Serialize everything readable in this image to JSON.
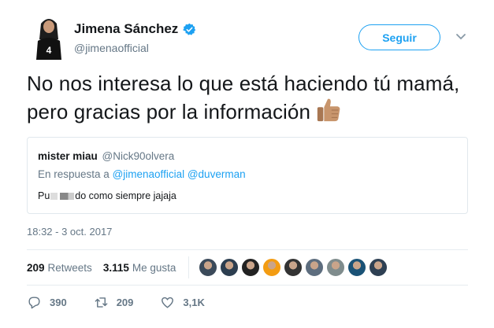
{
  "author": {
    "name": "Jimena Sánchez",
    "handle": "@jimenaofficial",
    "verified": true
  },
  "follow_label": "Seguir",
  "tweet_text": "No nos interesa lo que está haciendo tú mamá, pero gracias por la información",
  "quoted_tweet": {
    "name": "mister miau",
    "handle": "@Nick90olvera",
    "reply_prefix": "En respuesta a",
    "reply_to_1": "@jimenaofficial",
    "reply_to_2": "@duverman",
    "text_start": "Pu",
    "text_end": "do como siempre jajaja"
  },
  "timestamp": "18:32 - 3 oct. 2017",
  "stats": {
    "retweets_count": "209",
    "retweets_label": "Retweets",
    "likes_count": "3.115",
    "likes_label": "Me gusta"
  },
  "liker_avatar_colors": [
    "#3b4a5a",
    "#2c3e50",
    "#222222",
    "#f39c12",
    "#333333",
    "#5d6d7e",
    "#7f8c8d",
    "#1a5276",
    "#2e4053"
  ],
  "actions": {
    "reply_count": "390",
    "retweet_count": "209",
    "like_count": "3,1K"
  },
  "colors": {
    "accent": "#1da1f2",
    "secondary_text": "#657786",
    "primary_text": "#14171a"
  },
  "icons": [
    "verified-badge-icon",
    "chevron-down-icon",
    "thumbs-up-emoji",
    "reply-icon",
    "retweet-icon",
    "heart-icon"
  ]
}
